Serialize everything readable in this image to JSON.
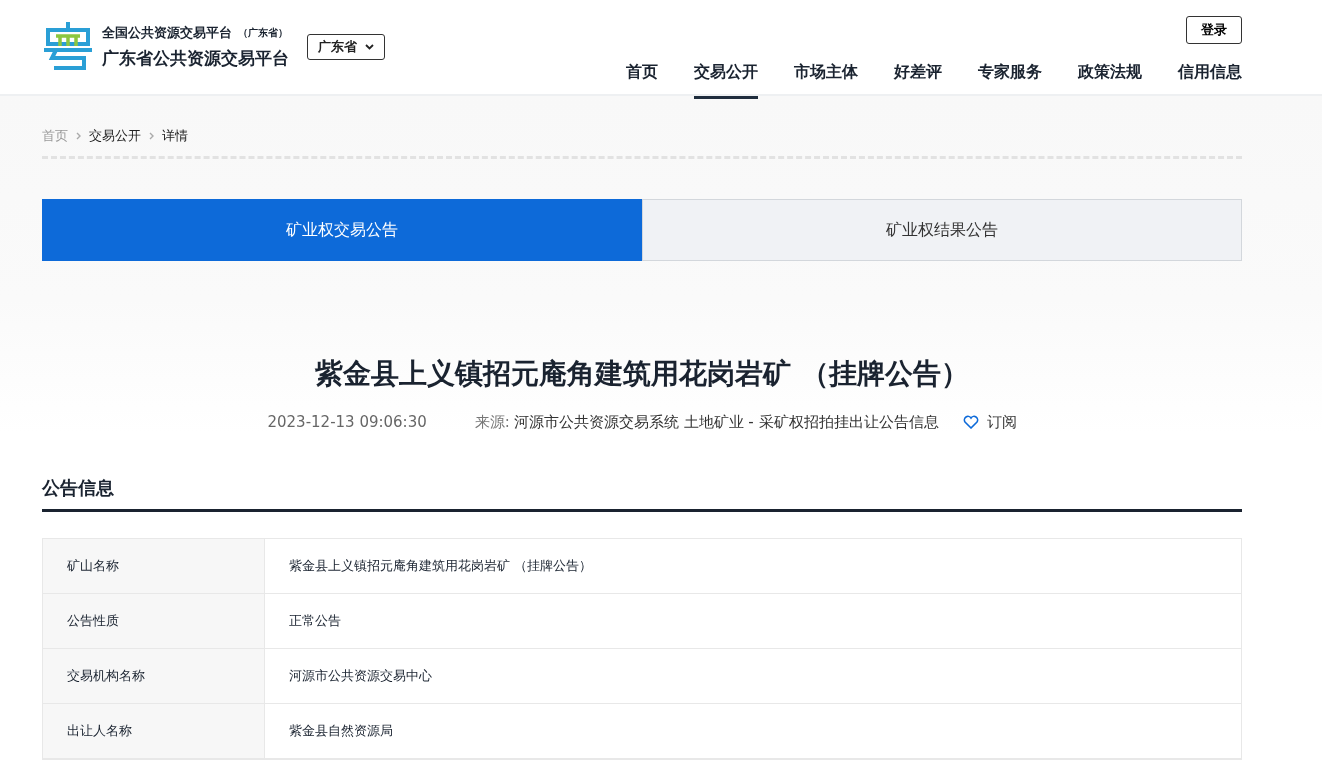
{
  "header": {
    "subtitle": "全国公共资源交易平台",
    "subtitle_note": "（广东省）",
    "title": "广东省公共资源交易平台",
    "region": "广东省",
    "login": "登录"
  },
  "nav": [
    {
      "label": "首页",
      "selected": false
    },
    {
      "label": "交易公开",
      "selected": true
    },
    {
      "label": "市场主体",
      "selected": false
    },
    {
      "label": "好差评",
      "selected": false
    },
    {
      "label": "专家服务",
      "selected": false
    },
    {
      "label": "政策法规",
      "selected": false
    },
    {
      "label": "信用信息",
      "selected": false
    }
  ],
  "breadcrumb": [
    "首页",
    "交易公开",
    "详情"
  ],
  "tabs": [
    {
      "label": "矿业权交易公告",
      "selected": true
    },
    {
      "label": "矿业权结果公告",
      "selected": false
    }
  ],
  "article": {
    "title": "紫金县上义镇招元庵角建筑用花岗岩矿 （挂牌公告）",
    "date": "2023-12-13 09:06:30",
    "source_label": "来源:",
    "source": "河源市公共资源交易系统 土地矿业 - 采矿权招拍挂出让公告信息",
    "subscribe": "订阅"
  },
  "section": {
    "title": "公告信息",
    "rows": [
      {
        "label": "矿山名称",
        "value": "紫金县上义镇招元庵角建筑用花岗岩矿 （挂牌公告）"
      },
      {
        "label": "公告性质",
        "value": "正常公告"
      },
      {
        "label": "交易机构名称",
        "value": "河源市公共资源交易中心"
      },
      {
        "label": "出让人名称",
        "value": "紫金县自然资源局"
      }
    ]
  }
}
